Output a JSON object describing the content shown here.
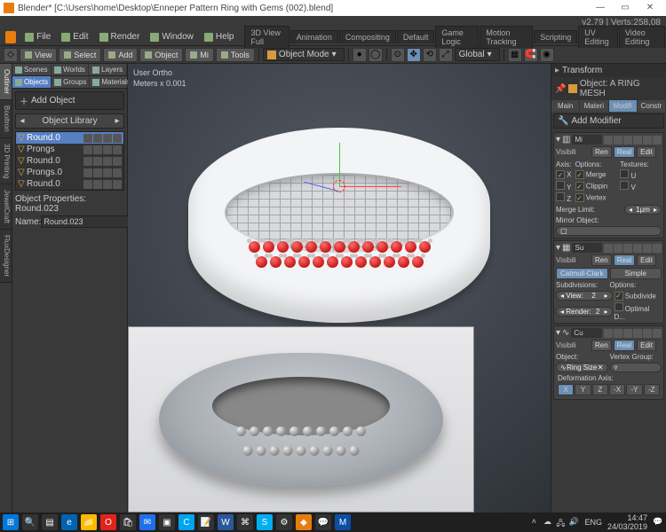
{
  "titlebar": {
    "text": "Blender* [C:\\Users\\home\\Desktop\\Enneper Pattern Ring with Gems (002).blend]"
  },
  "infobar": {
    "right": "v2.79 | Verts:258,08"
  },
  "menu": {
    "file": "File",
    "edit": "Edit",
    "render": "Render",
    "window": "Window",
    "help": "Help"
  },
  "workspaces": [
    "3D View Full",
    "Animation",
    "Compositing",
    "Default",
    "Game Logic",
    "Motion Tracking",
    "Scripting",
    "UV Editing",
    "Video Editing"
  ],
  "toolbar2": {
    "view": "View",
    "select": "Select",
    "add": "Add",
    "mesh": "Object",
    "mi": "Mi",
    "tools": "Tools",
    "mode": "Object Mode",
    "global": "Global"
  },
  "sidetabs": [
    "Outliner",
    "Booltron",
    "3D Printing",
    "JewelCraft",
    "FluxDesigner"
  ],
  "leftpanel": {
    "tabs": [
      "Scenes",
      "Worlds",
      "Layers",
      "Objects",
      "Groups",
      "Materials"
    ],
    "addobject": "Add Object",
    "objlib": "Object Library",
    "tree": [
      {
        "name": "Round.0"
      },
      {
        "name": "Prongs"
      },
      {
        "name": "Round.0"
      },
      {
        "name": "Prongs.0"
      },
      {
        "name": "Round.0"
      }
    ],
    "objprops_title": "Object Properties: Round.023",
    "name_label": "Name:",
    "name_value": "Round.023"
  },
  "viewport": {
    "orient": "User Ortho",
    "scale": "Meters x 0.001"
  },
  "rightpanel": {
    "transform": "Transform",
    "object_prefix": "Object: ",
    "object": "A RING MESH",
    "proptabs": [
      "Main",
      "Materi",
      "Modifi",
      "Constr"
    ],
    "addmod": "Add Modifier",
    "visibility": "Visibili",
    "mirror": {
      "name": "Mi",
      "axis_label": "Axis:",
      "options_label": "Options:",
      "textures_label": "Textures:",
      "merge": "Merge",
      "clip": "Clippin",
      "vertex": "Vertex",
      "u": "U",
      "v": "V",
      "mergelimit_label": "Merge Limit:",
      "mergelimit": "1µm",
      "mirrorobj": "Mirror Object:"
    },
    "subsurf": {
      "name": "Su",
      "catmull": "Catmull-Clark",
      "simple": "Simple",
      "subdiv_label": "Subdivisions:",
      "options_label": "Options:",
      "view_label": "View:",
      "view": "2",
      "render_label": "Render:",
      "render": "2",
      "subdivide": "Subdivide ",
      "optimal": "Optimal D..."
    },
    "curve": {
      "name": "Cu",
      "object_label": "Object:",
      "object": "Ring Size",
      "vgroup": "Vertex Group:",
      "deform": "Deformation Axis:"
    },
    "ren": "Ren",
    "real": "Real",
    "edit": "Edit"
  },
  "taskbar": {
    "lang": "ENG",
    "time": "14:47",
    "date": "24/03/2019"
  }
}
